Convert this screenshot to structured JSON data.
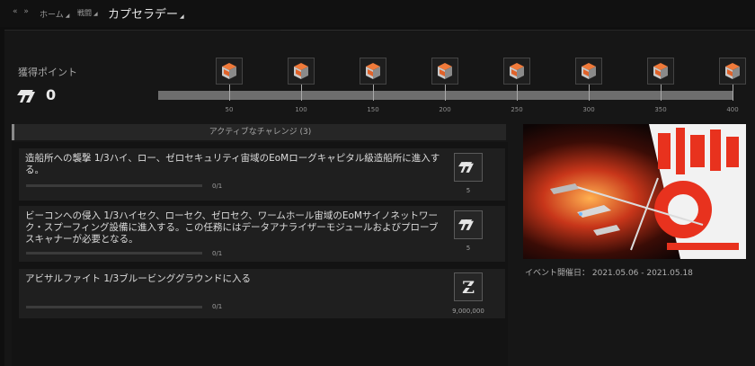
{
  "breadcrumb": {
    "nav_arrows": "« »",
    "home": "ホーム",
    "second": "戦闘",
    "title": "カプセラデー"
  },
  "points": {
    "label": "獲得ポイント",
    "value": "0",
    "icon": "flag-icon"
  },
  "milestones": {
    "labels": [
      "50",
      "100",
      "150",
      "200",
      "250",
      "300",
      "350",
      "400"
    ],
    "current_progress": 0,
    "reward_icon": "crate-icon"
  },
  "challenges": {
    "header": "アクティブなチャレンジ (3)",
    "items": [
      {
        "text": "造船所への襲撃 1/3ハイ、ロー、ゼロセキュリティ宙域のEoMローグキャピタル級造船所に進入する。",
        "progress": "0/1",
        "reward_value": "5",
        "reward_icon": "flag-icon"
      },
      {
        "text": "ビーコンへの侵入 1/3ハイセク、ローセク、ゼロセク、ワームホール宙域のEoMサイノネットワーク・スプーフィング設備に進入する。この任務にはデータアナライザーモジュールおよびプローブスキャナーが必要となる。",
        "progress": "0/1",
        "reward_value": "5",
        "reward_icon": "flag-icon"
      },
      {
        "text": "アビサルファイト 1/3ブルービンググラウンドに入る",
        "progress": "0/1",
        "reward_value": "9,000,000",
        "reward_icon": "isk-icon"
      }
    ]
  },
  "event": {
    "dates": "イベント開催日： 2021.05.06 - 2021.05.18"
  },
  "colors": {
    "background": "#0f0f0f",
    "panel": "#161616",
    "card": "#1f1f1f",
    "track": "#6e6e6e",
    "crate_orange": "#e0622a",
    "banner_red": "#e8321e"
  }
}
